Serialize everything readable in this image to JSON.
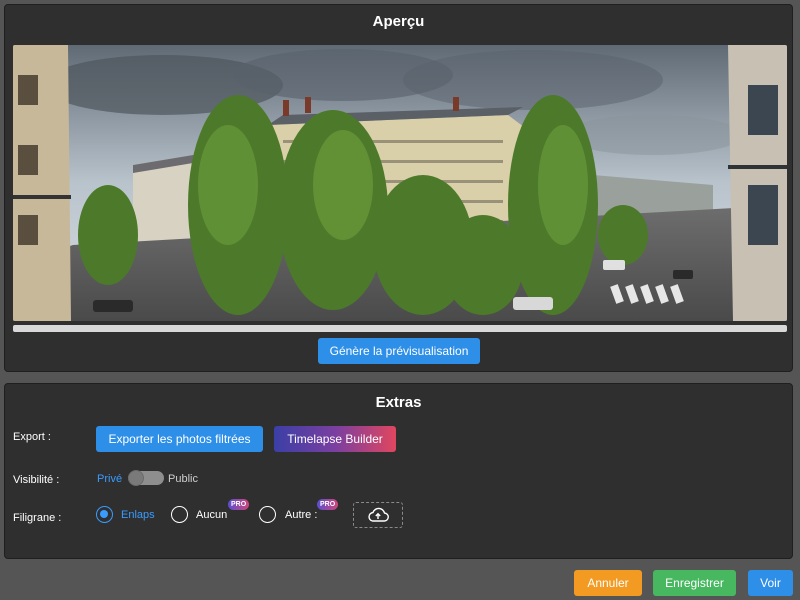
{
  "preview": {
    "title": "Aperçu",
    "generate_button": "Génère la prévisualisation",
    "progress": 1.0
  },
  "extras": {
    "title": "Extras",
    "export": {
      "label": "Export :",
      "export_photos_button": "Exporter les photos filtrées",
      "timelapse_button": "Timelapse Builder"
    },
    "visibility": {
      "label": "Visibilité :",
      "private_label": "Privé",
      "public_label": "Public",
      "selected": "Privé"
    },
    "watermark": {
      "label": "Filigrane :",
      "options": [
        {
          "label": "Enlaps",
          "selected": true,
          "pro": false
        },
        {
          "label": "Aucun",
          "selected": false,
          "pro": true
        },
        {
          "label": "Autre :",
          "selected": false,
          "pro": true
        }
      ],
      "pro_badge": "PRO",
      "upload_icon": "cloud-upload-icon"
    }
  },
  "footer": {
    "cancel_button": "Annuler",
    "save_button": "Enregistrer",
    "view_button": "Voir"
  },
  "colors": {
    "panel_bg": "#2f2f2f",
    "page_bg": "#555555",
    "accent_blue": "#2e8fe8",
    "link_blue": "#3a9bff",
    "cancel_orange": "#f29a22",
    "save_green": "#47b860"
  }
}
